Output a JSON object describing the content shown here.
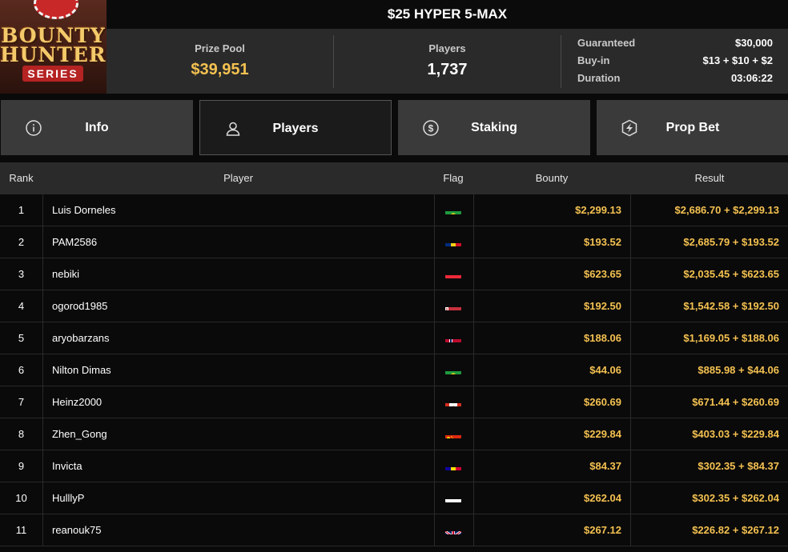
{
  "logo": {
    "line1": "BOUNTY",
    "line2": "HUNTERS",
    "line3": "SERIES"
  },
  "tournament": {
    "title": "$25 HYPER 5-MAX"
  },
  "stats": {
    "prize_pool_label": "Prize Pool",
    "prize_pool_value": "$39,951",
    "players_label": "Players",
    "players_value": "1,737",
    "guaranteed_label": "Guaranteed",
    "guaranteed_value": "$30,000",
    "buyin_label": "Buy-in",
    "buyin_value": "$13 + $10 + $2",
    "duration_label": "Duration",
    "duration_value": "03:06:22"
  },
  "tabs": [
    {
      "label": "Info",
      "icon": "info-icon",
      "active": false
    },
    {
      "label": "Players",
      "icon": "user-icon",
      "active": true
    },
    {
      "label": "Staking",
      "icon": "dollar-coin-icon",
      "active": false
    },
    {
      "label": "Prop Bet",
      "icon": "lightning-shield-icon",
      "active": false
    }
  ],
  "table": {
    "headers": {
      "rank": "Rank",
      "player": "Player",
      "flag": "Flag",
      "bounty": "Bounty",
      "result": "Result"
    },
    "rows": [
      {
        "rank": "1",
        "player": "Luis Dorneles",
        "flag": "brazil",
        "bounty": "$2,299.13",
        "result": "$2,686.70 + $2,299.13"
      },
      {
        "rank": "2",
        "player": "PAM2586",
        "flag": "romania",
        "bounty": "$193.52",
        "result": "$2,685.79 + $193.52"
      },
      {
        "rank": "3",
        "player": "nebiki",
        "flag": "austria",
        "bounty": "$623.65",
        "result": "$2,035.45 + $623.65"
      },
      {
        "rank": "4",
        "player": "ogorod1985",
        "flag": "belarus",
        "bounty": "$192.50",
        "result": "$1,542.58 + $192.50"
      },
      {
        "rank": "5",
        "player": "aryobarzans",
        "flag": "norway",
        "bounty": "$188.06",
        "result": "$1,169.05 + $188.06"
      },
      {
        "rank": "6",
        "player": "Nilton Dimas",
        "flag": "brazil",
        "bounty": "$44.06",
        "result": "$885.98 + $44.06"
      },
      {
        "rank": "7",
        "player": "Heinz2000",
        "flag": "canada",
        "bounty": "$260.69",
        "result": "$671.44 + $260.69"
      },
      {
        "rank": "8",
        "player": "Zhen_Gong",
        "flag": "china",
        "bounty": "$229.84",
        "result": "$403.03 + $229.84"
      },
      {
        "rank": "9",
        "player": "Invicta",
        "flag": "andorra",
        "bounty": "$84.37",
        "result": "$302.35 + $84.37"
      },
      {
        "rank": "10",
        "player": "HulllyP",
        "flag": "russia",
        "bounty": "$262.04",
        "result": "$302.35 + $262.04"
      },
      {
        "rank": "11",
        "player": "reanouk75",
        "flag": "united-kingdom",
        "bounty": "$267.12",
        "result": "$226.82 + $267.12"
      }
    ]
  },
  "colors": {
    "accent_gold": "#f4c150",
    "panel": "#2a2a2a",
    "tab": "#3a3a3a",
    "active_tab": "#1b1b1b"
  }
}
